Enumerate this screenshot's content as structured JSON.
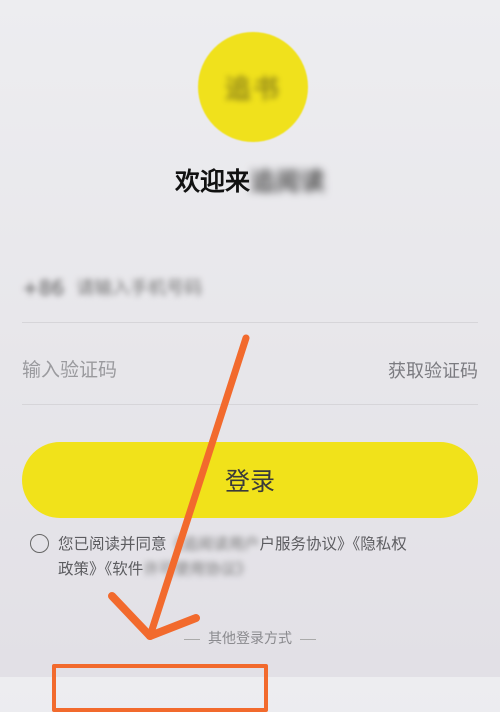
{
  "app": {
    "logo_text": "追书",
    "welcome_prefix": "欢迎来",
    "welcome_app_name": "追阅读"
  },
  "form": {
    "phone_prefix": "+86",
    "phone_placeholder": "请输入手机号码",
    "code_placeholder": "输入验证码",
    "get_code_label": "获取验证码",
    "login_label": "登录"
  },
  "agreement": {
    "text_1": "您已阅读并同意",
    "blur_1": "《追阅读用户",
    "text_2": "户服务协议》《隐私权",
    "text_3": "政策》《软件",
    "blur_2": "许可使用协议》"
  },
  "other_login": {
    "label": "其他登录方式"
  },
  "annotation": {
    "color": "#f26a2d"
  }
}
